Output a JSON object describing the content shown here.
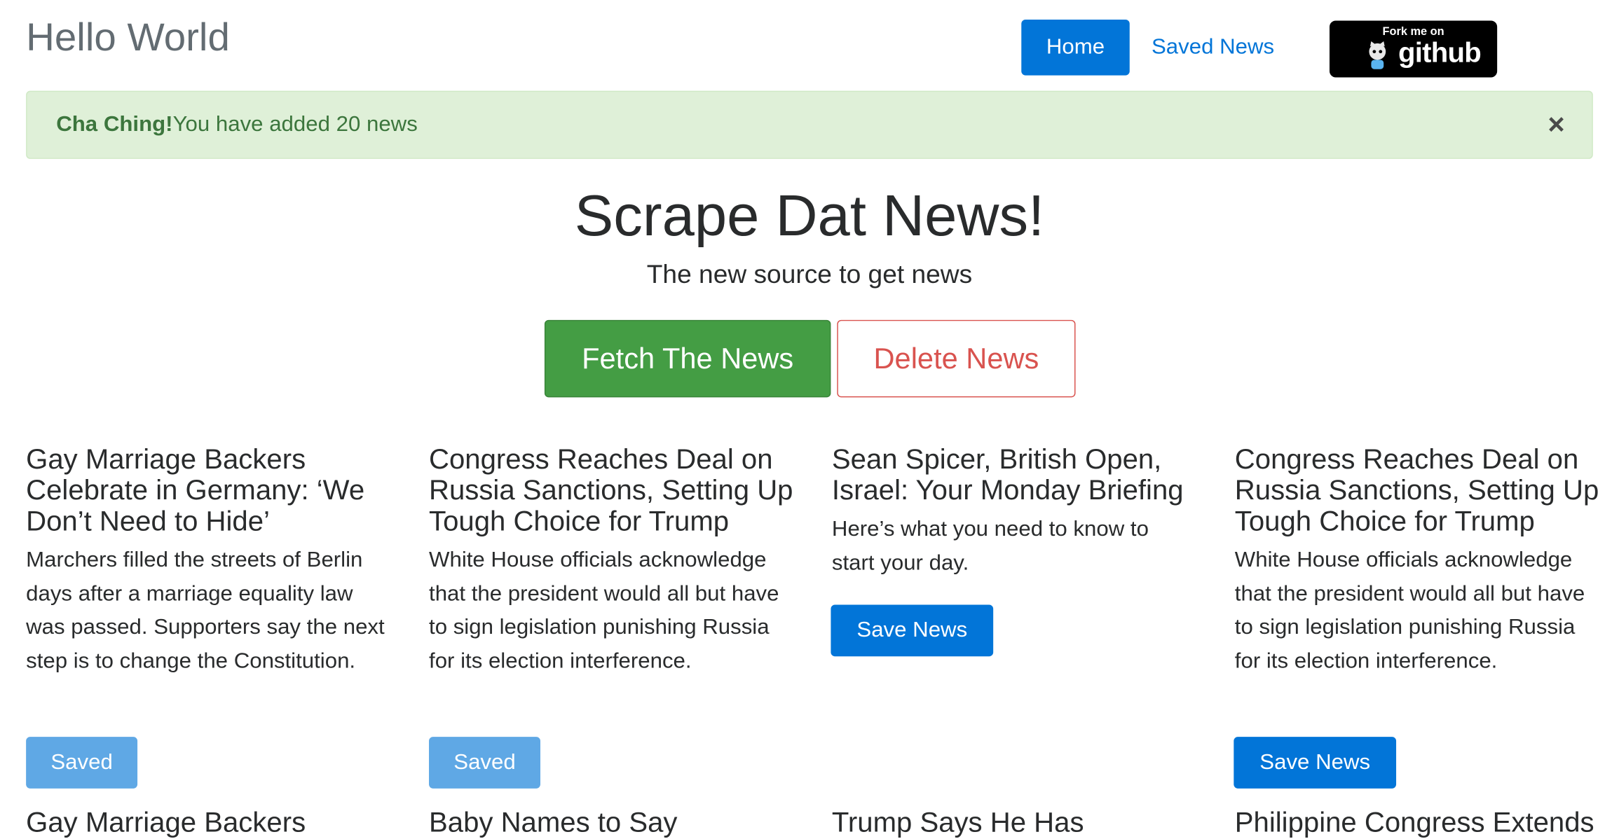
{
  "navbar": {
    "brand": "Hello World",
    "home_label": "Home",
    "saved_news_label": "Saved News",
    "github_badge": {
      "line1": "Fork me on",
      "line2": "github"
    }
  },
  "alert": {
    "strong": "Cha Ching!",
    "message": "You have added 20 news",
    "close_symbol": "×"
  },
  "hero": {
    "title": "Scrape Dat News!",
    "subtitle": "The new source to get news",
    "fetch_label": "Fetch The News",
    "delete_label": "Delete News"
  },
  "articles": [
    {
      "title": "Gay Marriage Backers Celebrate in Germany: ‘We Don’t Need to Hide’",
      "summary": "Marchers filled the streets of Berlin days after a marriage equality law was passed. Supporters say the next step is to change the Constitution.",
      "button": "Saved"
    },
    {
      "title": "Congress Reaches Deal on Russia Sanctions, Setting Up Tough Choice for Trump",
      "summary": "White House officials acknowledge that the president would all but have to sign legislation punishing Russia for its election interference.",
      "button": "Saved"
    },
    {
      "title": "Sean Spicer, British Open, Israel: Your Monday Briefing",
      "summary": "Here’s what you need to know to start your day.",
      "button": "Save News"
    },
    {
      "title": "Congress Reaches Deal on Russia Sanctions, Setting Up Tough Choice for Trump",
      "summary": "White House officials acknowledge that the president would all but have to sign legislation punishing Russia for its election interference.",
      "button": "Save News"
    }
  ],
  "next_row_peek": [
    "Gay Marriage Backers",
    "Baby Names to Say",
    "Trump Says He Has",
    "Philippine Congress Extends"
  ],
  "colors": {
    "primary": "#0275d8",
    "primary_disabled": "#5fa8e5",
    "success": "#449d44",
    "danger": "#d9534f",
    "alert_bg": "#dff0d8",
    "alert_text": "#3c763d"
  }
}
